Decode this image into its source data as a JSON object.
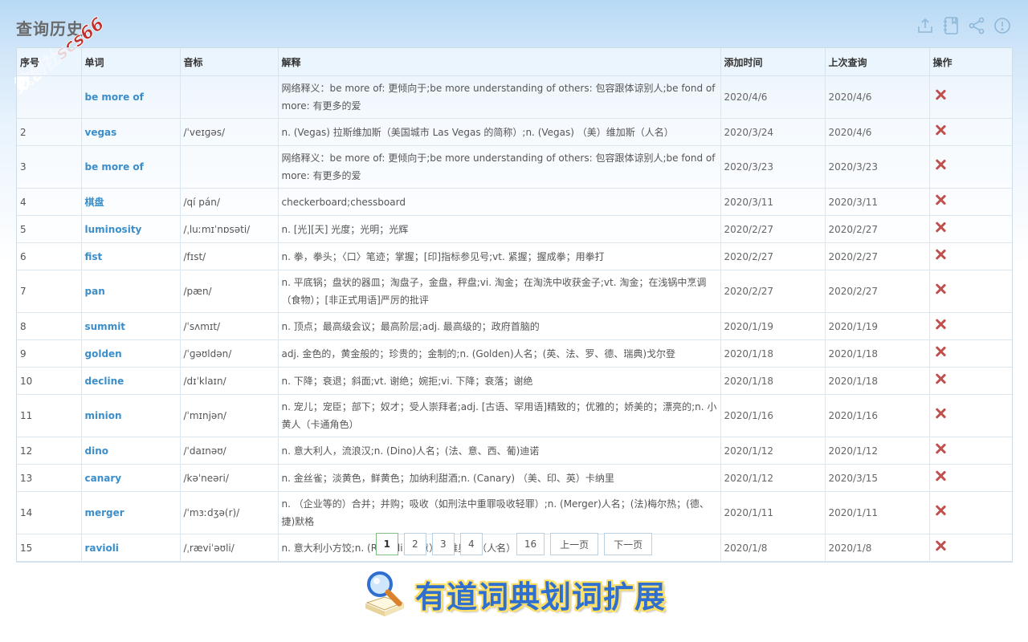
{
  "page": {
    "title": "查询历史",
    "watermark": "数创社scs66"
  },
  "toolbar": {
    "icons": [
      "export-icon",
      "notebook-icon",
      "share-icon",
      "feedback-icon"
    ]
  },
  "table": {
    "columns": [
      "序号",
      "单词",
      "音标",
      "解释",
      "添加时间",
      "上次查询",
      "操作"
    ],
    "rows": [
      {
        "no": "",
        "word": "be more of",
        "phonetic": "",
        "meaning": "网络释义：be more of: 更倾向于;be more understanding of others: 包容跟体谅别人;be fond of more: 有更多的爱",
        "added": "2020/4/6",
        "last": "2020/4/6"
      },
      {
        "no": "2",
        "word": "vegas",
        "phonetic": "/ˈveɪɡəs/",
        "meaning": "n. (Vegas) 拉斯维加斯（美国城市 Las Vegas 的简称）;n. (Vegas) （美）维加斯（人名）",
        "added": "2020/3/24",
        "last": "2020/4/6"
      },
      {
        "no": "3",
        "word": "be more of",
        "phonetic": "",
        "meaning": "网络释义：be more of: 更倾向于;be more understanding of others: 包容跟体谅别人;be fond of more: 有更多的爱",
        "added": "2020/3/23",
        "last": "2020/3/23"
      },
      {
        "no": "4",
        "word": "棋盘",
        "phonetic": "/qí pán/",
        "meaning": "checkerboard;chessboard",
        "added": "2020/3/11",
        "last": "2020/3/11"
      },
      {
        "no": "5",
        "word": "luminosity",
        "phonetic": "/ˌluːmɪˈnɒsəti/",
        "meaning": "n. [光][天] 光度；光明；光辉",
        "added": "2020/2/27",
        "last": "2020/2/27"
      },
      {
        "no": "6",
        "word": "fist",
        "phonetic": "/fɪst/",
        "meaning": "n. 拳，拳头；〈口〉笔迹；掌握；[印]指标参见号;vt. 紧握；握成拳；用拳打",
        "added": "2020/2/27",
        "last": "2020/2/27"
      },
      {
        "no": "7",
        "word": "pan",
        "phonetic": "/pæn/",
        "meaning": "n. 平底锅；盘状的器皿；淘盘子，金盘，秤盘;vi. 淘金；在淘洗中收获金子;vt. 淘金；在浅锅中烹调（食物）；[非正式用语]严厉的批评",
        "added": "2020/2/27",
        "last": "2020/2/27"
      },
      {
        "no": "8",
        "word": "summit",
        "phonetic": "/ˈsʌmɪt/",
        "meaning": "n. 顶点；最高级会议；最高阶层;adj. 最高级的；政府首脑的",
        "added": "2020/1/19",
        "last": "2020/1/19"
      },
      {
        "no": "9",
        "word": "golden",
        "phonetic": "/ˈɡəʊldən/",
        "meaning": "adj. 金色的，黄金般的；珍贵的；金制的;n. (Golden)人名；(英、法、罗、德、瑞典)戈尔登",
        "added": "2020/1/18",
        "last": "2020/1/18"
      },
      {
        "no": "10",
        "word": "decline",
        "phonetic": "/dɪˈklaɪn/",
        "meaning": "n. 下降；衰退；斜面;vt. 谢绝；婉拒;vi. 下降；衰落；谢绝",
        "added": "2020/1/18",
        "last": "2020/1/18"
      },
      {
        "no": "11",
        "word": "minion",
        "phonetic": "/ˈmɪnjən/",
        "meaning": "n. 宠儿；宠臣；部下；奴才；受人崇拜者;adj. [古语、罕用语]精致的；优雅的；娇美的；漂亮的;n. 小黄人（卡通角色）",
        "added": "2020/1/16",
        "last": "2020/1/16"
      },
      {
        "no": "12",
        "word": "dino",
        "phonetic": "/ˈdaɪnəʊ/",
        "meaning": "n. 意大利人，流浪汉;n. (Dino)人名；(法、意、西、葡)迪诺",
        "added": "2020/1/12",
        "last": "2020/1/12"
      },
      {
        "no": "13",
        "word": "canary",
        "phonetic": "/kəˈneəri/",
        "meaning": "n. 金丝雀；淡黄色，鲜黄色；加纳利甜酒;n. (Canary) （美、印、英）卡纳里",
        "added": "2020/1/12",
        "last": "2020/3/15"
      },
      {
        "no": "14",
        "word": "merger",
        "phonetic": "/ˈmɜːdʒə(r)/",
        "meaning": "n. （企业等的）合并；并购；吸收（如刑法中重罪吸收轻罪）;n. (Merger)人名；(法)梅尔热；(德、捷)默格",
        "added": "2020/1/11",
        "last": "2020/1/11"
      },
      {
        "no": "15",
        "word": "ravioli",
        "phonetic": "/ˌræviˈəʊli/",
        "meaning": "n. 意大利小方饺;n. (Ravioli) （意）拉维奥利（人名）",
        "added": "2020/1/8",
        "last": "2020/1/8"
      }
    ]
  },
  "pagination": {
    "pages": [
      "1",
      "2",
      "3",
      "4"
    ],
    "ellipsis": "...",
    "last": "16",
    "prev": "上一页",
    "next": "下一页",
    "current": "1"
  },
  "banner": {
    "text": "有道词典划词扩展"
  }
}
